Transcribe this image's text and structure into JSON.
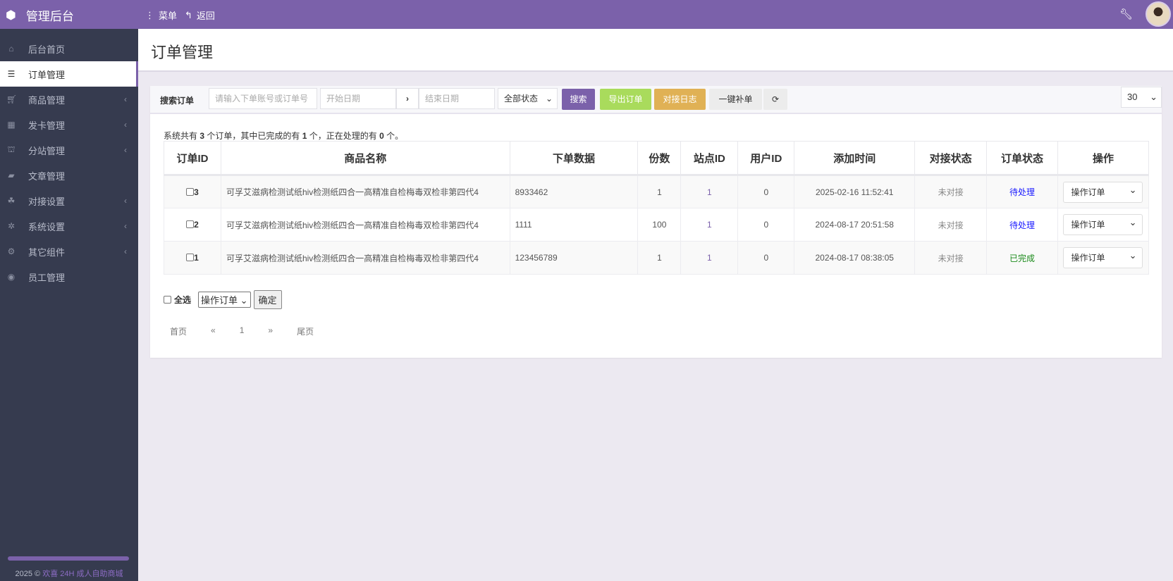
{
  "topbar": {
    "brand": "管理后台",
    "menu": "菜单",
    "back": "返回",
    "colors": {
      "primary": "#7b61aa"
    }
  },
  "sidebar": {
    "items": [
      {
        "label": "后台首页",
        "icon": "home-icon",
        "chev": false
      },
      {
        "label": "订单管理",
        "icon": "list-icon",
        "chev": false,
        "active": true
      },
      {
        "label": "商品管理",
        "icon": "cart-icon",
        "chev": true
      },
      {
        "label": "发卡管理",
        "icon": "grid-icon",
        "chev": true
      },
      {
        "label": "分站管理",
        "icon": "sitemap-icon",
        "chev": true
      },
      {
        "label": "文章管理",
        "icon": "book-icon",
        "chev": false
      },
      {
        "label": "对接设置",
        "icon": "cubes-icon",
        "chev": true
      },
      {
        "label": "系统设置",
        "icon": "gear-icon",
        "chev": true
      },
      {
        "label": "其它组件",
        "icon": "gears-icon",
        "chev": true
      },
      {
        "label": "员工管理",
        "icon": "user-circle-icon",
        "chev": false
      }
    ],
    "footer_year": "2025 ©",
    "footer_link": "欢喜 24H 成人自助商城"
  },
  "page": {
    "title": "订单管理"
  },
  "search": {
    "label": "搜索订单",
    "keyword_placeholder": "请输入下单账号或订单号",
    "start_placeholder": "开始日期",
    "end_placeholder": "结束日期",
    "status": "全部状态",
    "search_btn": "搜索",
    "export_btn": "导出订单",
    "log_btn": "对接日志",
    "refill_btn": "一键补单",
    "page_size": "30"
  },
  "summary": {
    "p1": "系统共有 ",
    "total": "3",
    "p2": " 个订单，其中已完成的有 ",
    "done": "1",
    "p3": " 个，正在处理的有 ",
    "processing": "0",
    "p4": " 个。"
  },
  "table": {
    "headers": [
      "订单ID",
      "商品名称",
      "下单数据",
      "份数",
      "站点ID",
      "用户ID",
      "添加时间",
      "对接状态",
      "订单状态",
      "操作"
    ],
    "rows": [
      {
        "id": "3",
        "name": "可孚艾滋病检测试纸hiv检测纸四合一高精准自检梅毒双检非第四代4",
        "data": "8933462",
        "qty": "1",
        "site": "1",
        "user": "0",
        "time": "2025-02-16 11:52:41",
        "dock": "未对接",
        "status": "待处理",
        "status_color": "#1a1aff",
        "op": "操作订单"
      },
      {
        "id": "2",
        "name": "可孚艾滋病检测试纸hiv检测纸四合一高精准自检梅毒双检非第四代4",
        "data": "1111",
        "qty": "100",
        "site": "1",
        "user": "0",
        "time": "2024-08-17 20:51:58",
        "dock": "未对接",
        "status": "待处理",
        "status_color": "#1a1aff",
        "op": "操作订单"
      },
      {
        "id": "1",
        "name": "可孚艾滋病检测试纸hiv检测纸四合一高精准自检梅毒双检非第四代4",
        "data": "123456789",
        "qty": "1",
        "site": "1",
        "user": "0",
        "time": "2024-08-17 08:38:05",
        "dock": "未对接",
        "status": "已完成",
        "status_color": "#1a8a1a",
        "op": "操作订单"
      }
    ]
  },
  "bulk": {
    "select_all": "全选",
    "action": "操作订单",
    "confirm": "确定"
  },
  "pager": [
    "首页",
    "«",
    "1",
    "»",
    "尾页"
  ]
}
